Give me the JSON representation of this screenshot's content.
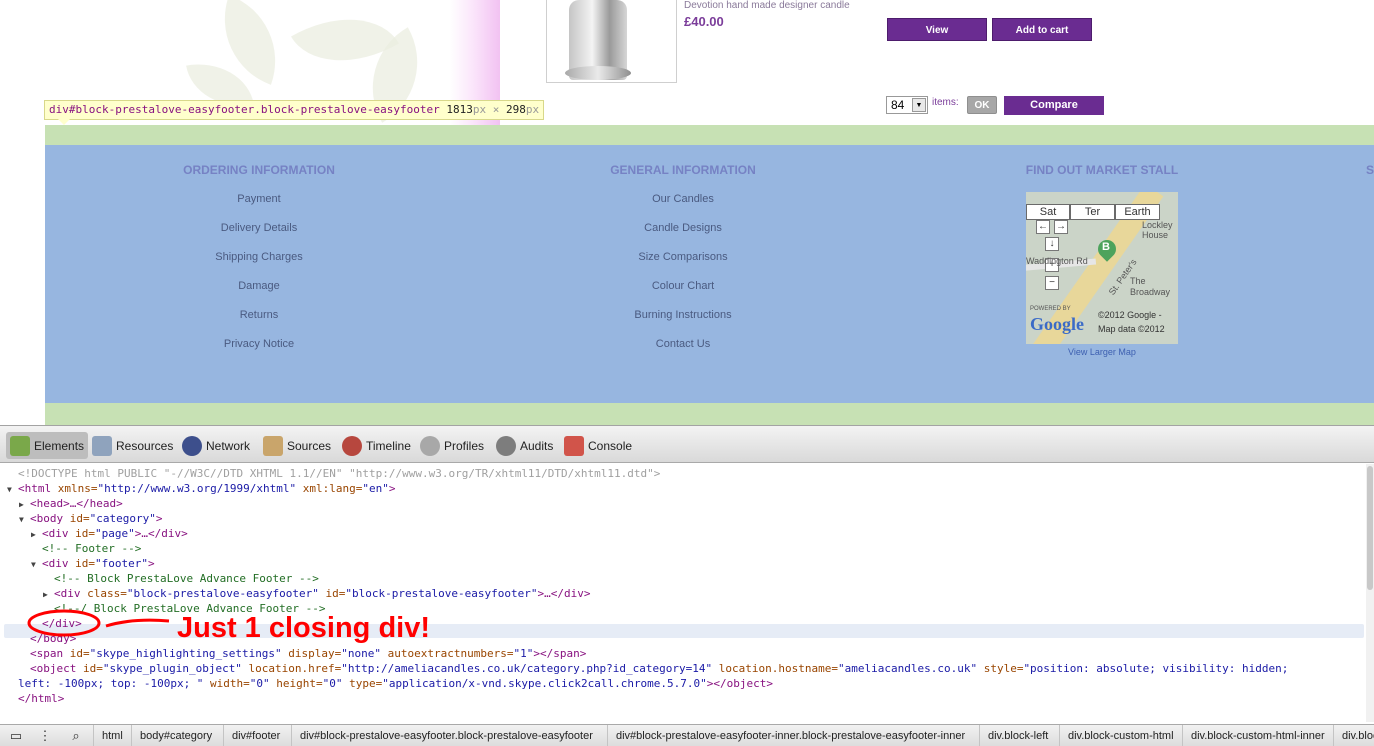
{
  "product": {
    "name": "Devotion  hand made designer candle",
    "price": "£40.00",
    "view_label": "View",
    "add_to_cart_label": "Add to cart"
  },
  "inspector_tooltip": {
    "selector": "div#block-prestalove-easyfooter.block-prestalove-easyfooter",
    "width": "1813",
    "height": "298",
    "unit": "px",
    "times": "×"
  },
  "pagination": {
    "items_per_page": "84",
    "items_label": "items:",
    "ok_label": "OK",
    "compare_label": "Compare"
  },
  "footer": {
    "ordering": {
      "title": "ORDERING INFORMATION",
      "links": [
        "Payment",
        "Delivery Details",
        "Shipping Charges",
        "Damage",
        "Returns",
        "Privacy Notice"
      ]
    },
    "general": {
      "title": "GENERAL INFORMATION",
      "links": [
        "Our Candles",
        "Candle Designs",
        "Size Comparisons",
        "Colour Chart",
        "Burning Instructions",
        "Contact Us"
      ]
    },
    "market": {
      "title": "FIND OUT MARKET STALL",
      "view_larger": "View Larger Map"
    },
    "fourth_title": "S"
  },
  "map": {
    "tabs": [
      "Sat",
      "Ter",
      "Earth"
    ],
    "pin_letter": "B",
    "labels": [
      "Lockley House",
      "Waddington Rd",
      "St. Peter's",
      "The Broadway"
    ],
    "powered_by": "POWERED BY",
    "logo": "Google",
    "copyright_1": "©2012 Google -",
    "copyright_2": "Map data ©2012"
  },
  "devtools": {
    "tabs": [
      "Elements",
      "Resources",
      "Network",
      "Sources",
      "Timeline",
      "Profiles",
      "Audits",
      "Console"
    ],
    "active_tab": "Elements",
    "breadcrumbs": [
      "html",
      "body#category",
      "div#footer",
      "div#block-prestalove-easyfooter.block-prestalove-easyfooter",
      "div#block-prestalove-easyfooter-inner.block-prestalove-easyfooter-inner",
      "div.block-left",
      "div.block-custom-html",
      "div.block-custom-html-inner",
      "div.block"
    ],
    "code": {
      "doctype": "<!DOCTYPE html PUBLIC \"-//W3C//DTD XHTML 1.1//EN\" \"http://www.w3.org/TR/xhtml11/DTD/xhtml11.dtd\">",
      "html_open_tag": "<html",
      "html_xmlns_attr": " xmlns=",
      "html_xmlns_val": "\"http://www.w3.org/1999/xhtml\"",
      "html_lang_attr": " xml:lang=",
      "html_lang_val": "\"en\"",
      "head": "<head>…</head>",
      "body_open": "<body",
      "body_id_attr": " id=",
      "body_id_val": "\"category\"",
      "page_div_open": "<div",
      "page_div_id_attr": " id=",
      "page_div_id_val": "\"page\"",
      "page_div_close": ">…</div>",
      "comment_footer": "<!-- Footer -->",
      "footer_div_open": "<div",
      "footer_id_attr": " id=",
      "footer_id_val": "\"footer\"",
      "comment_block_start": "<!-- Block PrestaLove Advance Footer -->",
      "block_div_open": "<div",
      "block_class_attr": " class=",
      "block_class_val": "\"block-prestalove-easyfooter\"",
      "block_id_attr": " id=",
      "block_id_val": "\"block-prestalove-easyfooter\"",
      "block_div_close": ">…</div>",
      "comment_block_end": "<!--/ Block PrestaLove Advance Footer -->",
      "div_close": "</div>",
      "body_close": "</body>",
      "span_open": "<span",
      "span_id_attr": " id=",
      "span_id_val": "\"skype_highlighting_settings\"",
      "span_display_attr": " display=",
      "span_display_val": "\"none\"",
      "span_auto_attr": " autoextractnumbers=",
      "span_auto_val": "\"1\"",
      "span_close": "></span>",
      "object_open": "<object",
      "object_id_attr": " id=",
      "object_id_val": "\"skype_plugin_object\"",
      "object_href_attr": " location.href=",
      "object_href_val": "\"http://ameliacandles.co.uk/category.php?id_category=14\"",
      "object_host_attr": " location.hostname=",
      "object_host_val": "\"ameliacandles.co.uk\"",
      "object_style_attr": " style=",
      "object_style_val_1": "\"position: absolute; visibility: hidden;",
      "object_style_val_2": "left: -100px; top: -100px; \"",
      "object_width_attr": " width=",
      "object_width_val": "\"0\"",
      "object_height_attr": " height=",
      "object_height_val": "\"0\"",
      "object_type_attr": " type=",
      "object_type_val": "\"application/x-vnd.skype.click2call.chrome.5.7.0\"",
      "object_close": "></object>",
      "html_close": "</html>"
    }
  },
  "annotation": {
    "text": "Just 1 closing div!",
    "color": "#ff0000"
  },
  "colors": {
    "purple_button": "#6a2c91",
    "footer_blue": "#97b6e0",
    "footer_green": "#c7e1b4",
    "footer_title": "#7682c4"
  }
}
